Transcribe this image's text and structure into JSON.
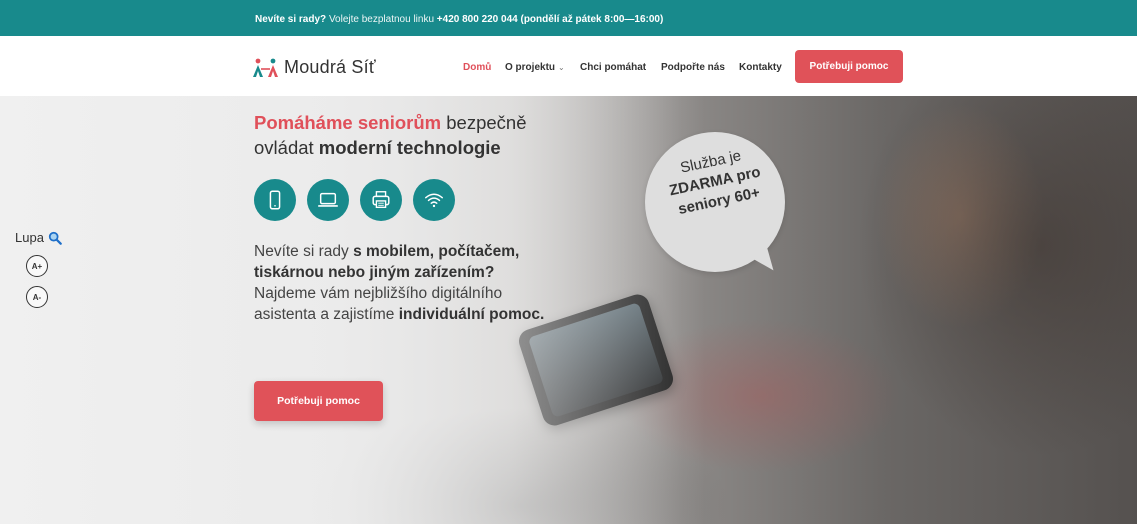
{
  "topbar": {
    "question": "Nevíte si rady?",
    "text": "Volejte bezplatnou linku",
    "phone": "+420 800 220 044 (pondělí až pátek 8:00—16:00)"
  },
  "header": {
    "logo_text": "Moudrá Síť",
    "nav": {
      "home": "Domů",
      "about": "O projektu",
      "help": "Chci pomáhat",
      "support": "Podpořte nás",
      "contacts": "Kontakty"
    },
    "cta": "Potřebuji pomoc"
  },
  "hero": {
    "headline_highlight": "Pomáháme seniorům",
    "headline_part2": "bezpečně ovládat",
    "headline_bold": "moderní technologie",
    "icons": [
      "phone-icon",
      "laptop-icon",
      "printer-icon",
      "wifi-icon"
    ],
    "para_1": "Nevíte si rady",
    "para_2_bold": "s mobilem, počítačem, tiskárnou nebo jiným zařízením?",
    "para_3": "Najdeme vám nejbližšího digitálního asistenta a zajistíme",
    "para_4_bold": "individuální pomoc.",
    "cta": "Potřebuji pomoc",
    "bubble_line1": "Služba je",
    "bubble_line2": "ZDARMA pro",
    "bubble_line3": "seniory 60+"
  },
  "accessibility": {
    "label": "Lupa",
    "zoom_in": "A+",
    "zoom_out": "A-"
  },
  "colors": {
    "teal": "#188a8c",
    "accent": "#e05259"
  }
}
